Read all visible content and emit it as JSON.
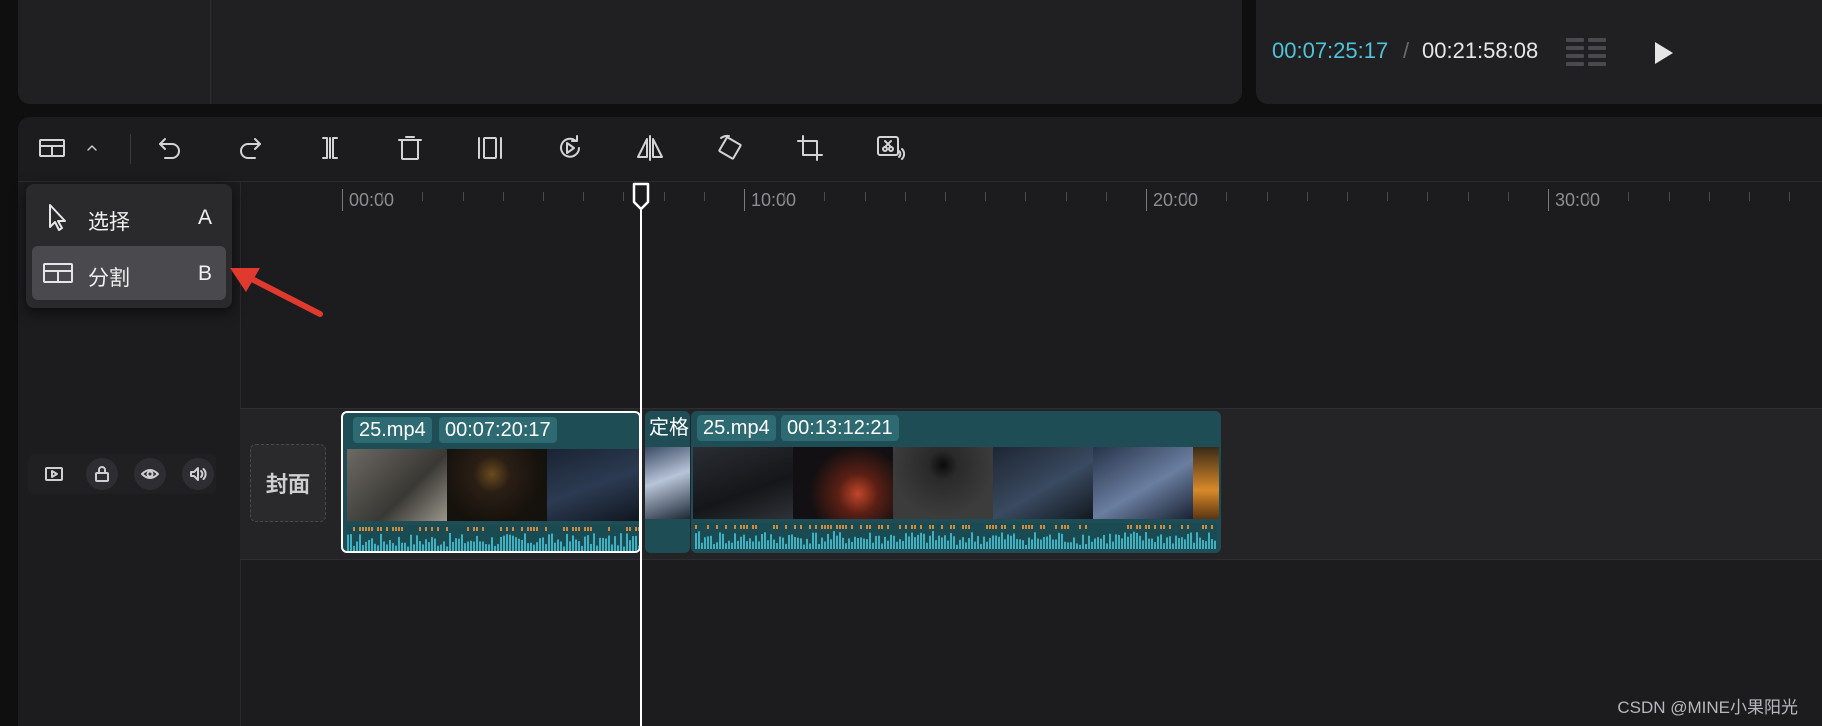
{
  "player": {
    "current_time": "00:07:25:17",
    "separator": "/",
    "total_time": "00:21:58:08",
    "accent_color": "#4fc3d9"
  },
  "toolbar": {
    "mode_icon": "split-mode-icon",
    "tools": [
      "undo-icon",
      "redo-icon",
      "split-clip-icon",
      "delete-icon",
      "freeze-frame-icon",
      "reverse-icon",
      "mirror-icon",
      "rotate-icon",
      "crop-icon",
      "smart-cut-icon"
    ]
  },
  "mode_menu": {
    "items": [
      {
        "label": "选择",
        "shortcut": "A",
        "icon": "cursor-icon",
        "selected": false
      },
      {
        "label": "分割",
        "shortcut": "B",
        "icon": "split-mode-icon",
        "selected": true
      }
    ]
  },
  "ruler": {
    "labels": [
      "00:00",
      "10:00",
      "20:00",
      "30:00"
    ]
  },
  "track": {
    "cover_label": "封面",
    "controls": [
      "video-track-icon",
      "lock-icon",
      "eye-icon",
      "volume-icon"
    ],
    "clips": [
      {
        "name": "25.mp4",
        "duration": "00:07:20:17",
        "selected": true
      },
      {
        "name": "定格",
        "duration": "",
        "selected": false
      },
      {
        "name": "25.mp4",
        "duration": "00:13:12:21",
        "selected": false
      }
    ],
    "clip_color": "#1f4d55"
  },
  "annotation": {
    "arrow_color": "#e03a2e"
  },
  "watermark": "CSDN @MINE小果阳光"
}
